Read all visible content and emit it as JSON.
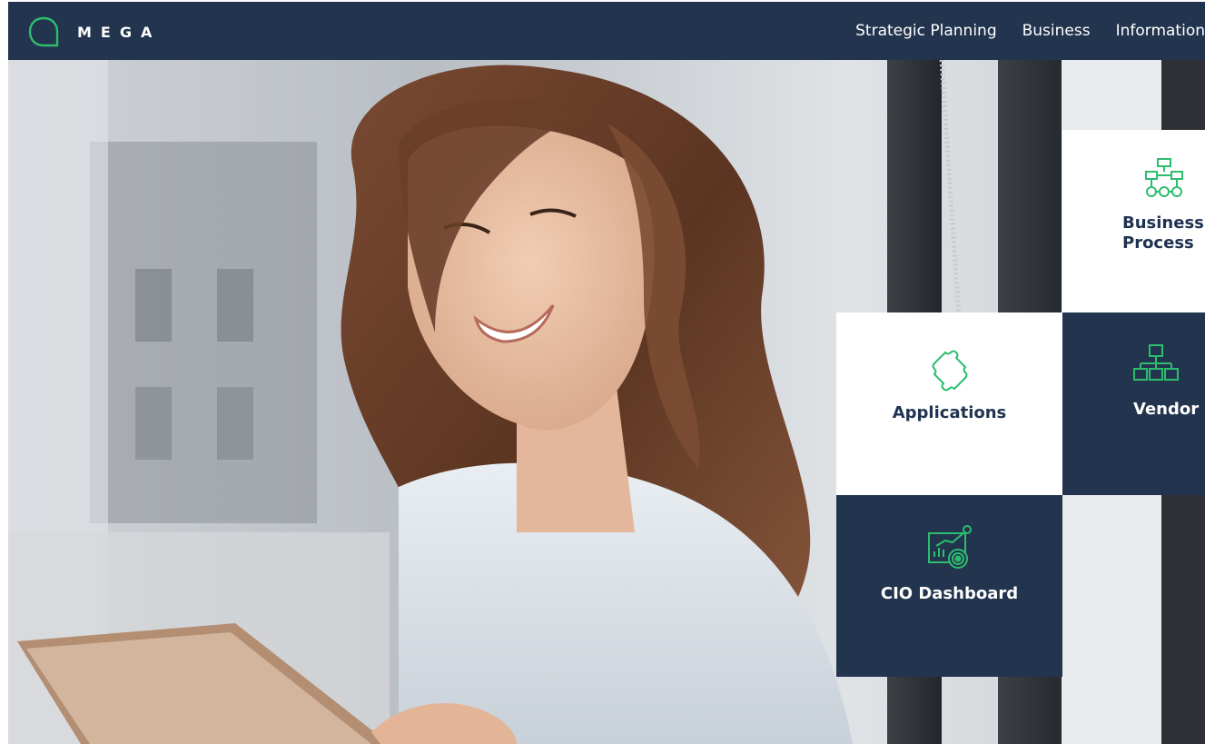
{
  "brand": {
    "name": "MEGA",
    "accent_color": "#2dbd6e",
    "navy_color": "#22344e"
  },
  "nav": {
    "items": [
      {
        "label": "Strategic Planning"
      },
      {
        "label": "Business"
      },
      {
        "label": "Information"
      }
    ]
  },
  "hero": {
    "image_icon": "hero-photo"
  },
  "tiles": [
    {
      "label": "Business\nProcess",
      "icon": "process-diagram-icon",
      "style": "white"
    },
    {
      "label": "Applications",
      "icon": "puzzle-icon",
      "style": "white"
    },
    {
      "label": "Vendor",
      "icon": "org-chart-icon",
      "style": "navy"
    },
    {
      "label": "CIO Dashboard",
      "icon": "dashboard-chart-icon",
      "style": "navy"
    }
  ]
}
